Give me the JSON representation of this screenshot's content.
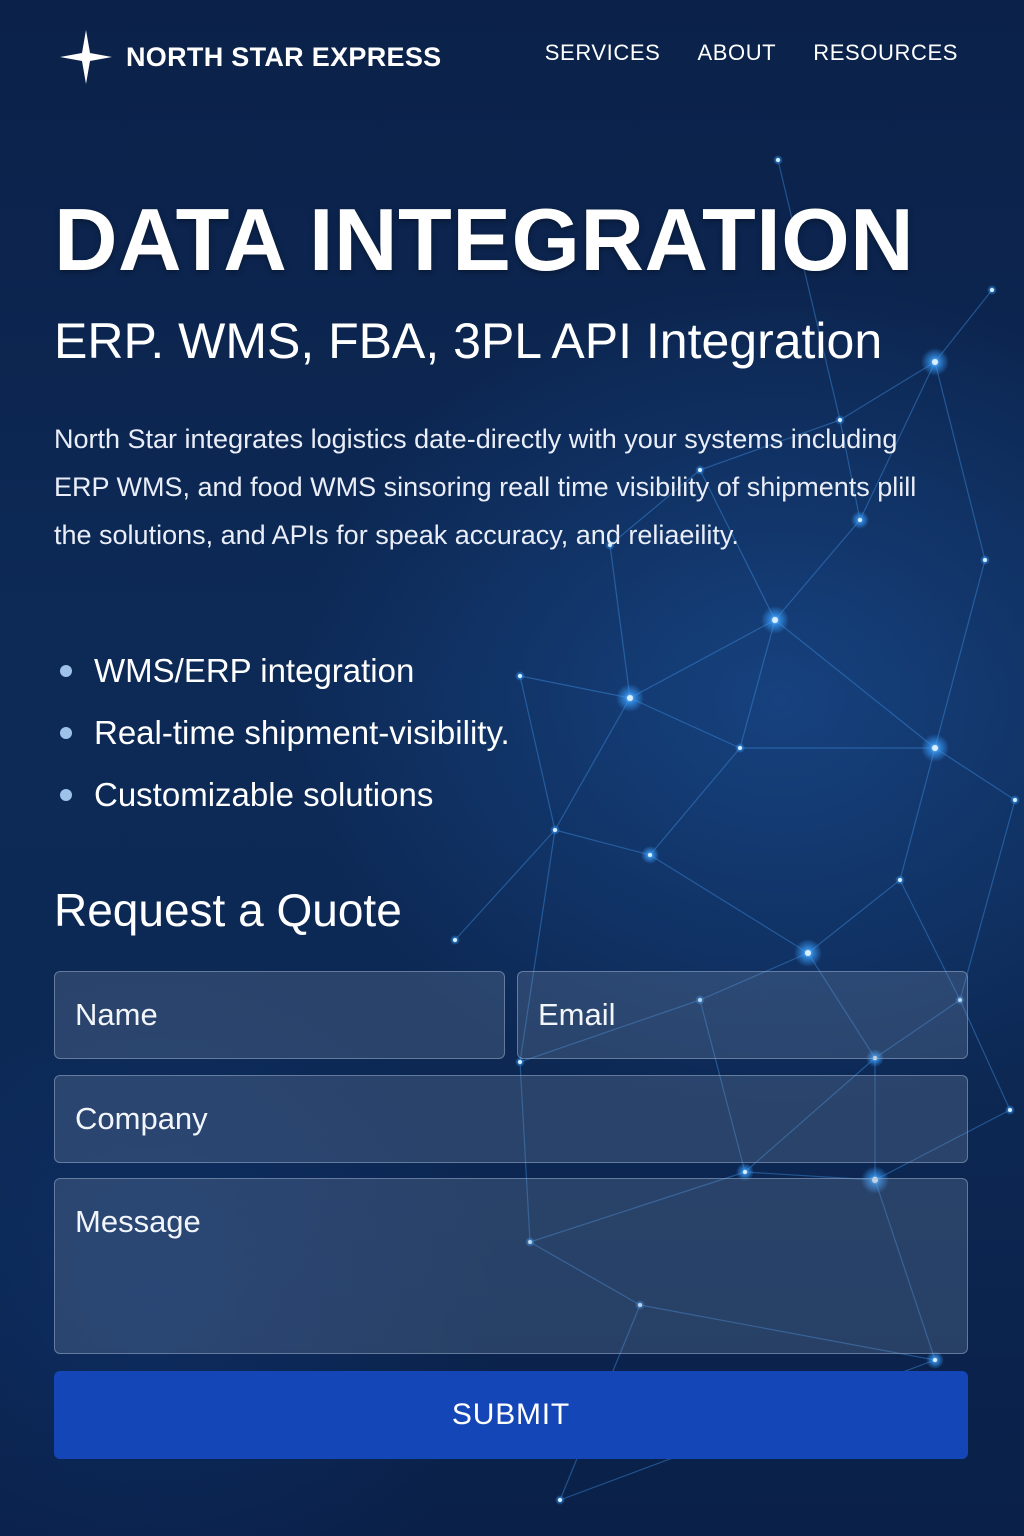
{
  "brand": {
    "name": "NORTH STAR EXPRESS",
    "logo_icon": "four-point-star-icon"
  },
  "nav": {
    "items": [
      {
        "label": "SERVICES"
      },
      {
        "label": "ABOUT"
      },
      {
        "label": "RESOURCES"
      }
    ]
  },
  "hero": {
    "title": "DATA INTEGRATION",
    "subtitle": "ERP. WMS, FBA, 3PL API Integration",
    "description": "North Star integrates logistics date-directly with your systems including ERP  WMS, and food WMS sinsoring reall time visibility of shipments plill the solutions, and APIs for speak accuracy, and reliaeility."
  },
  "features": [
    {
      "label": "WMS/ERP integration"
    },
    {
      "label": "Real-time shipment-visibility."
    },
    {
      "label": "Customizable solutions"
    }
  ],
  "quote_form": {
    "title": "Request a Quote",
    "name": {
      "value": "",
      "placeholder": "Name"
    },
    "email": {
      "value": "",
      "placeholder": "Email"
    },
    "company": {
      "value": "",
      "placeholder": "Company"
    },
    "message": {
      "value": "",
      "placeholder": "Message"
    },
    "submit_label": "SUBMIT"
  },
  "colors": {
    "background": "#0d2a57",
    "accent": "#1546b8",
    "network_glow": "#3aa0ff",
    "bullet": "#9fc2ea"
  }
}
